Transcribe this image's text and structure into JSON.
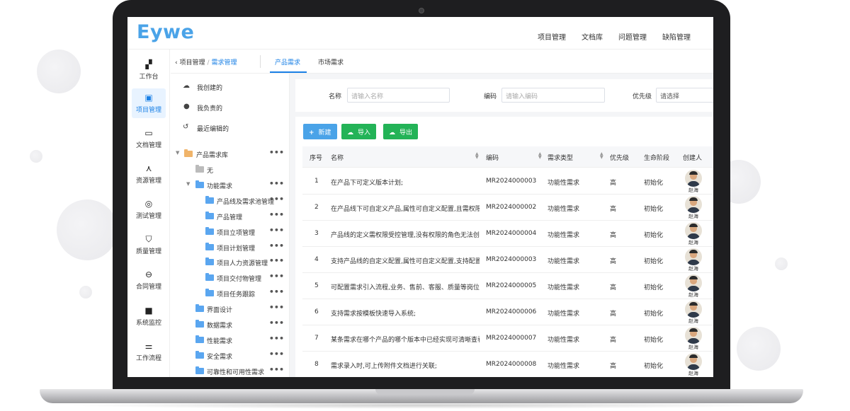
{
  "app": {
    "logo": "Eywe",
    "top_nav": [
      "项目管理",
      "文档库",
      "问题管理",
      "缺陷管理"
    ]
  },
  "sidebar": {
    "items": [
      {
        "label": "工作台",
        "icon": "dashboard-icon",
        "active": false
      },
      {
        "label": "项目管理",
        "icon": "clipboard-icon",
        "active": true
      },
      {
        "label": "文档管理",
        "icon": "folder-icon",
        "active": false
      },
      {
        "label": "资源管理",
        "icon": "network-icon",
        "active": false
      },
      {
        "label": "测试管理",
        "icon": "target-icon",
        "active": false
      },
      {
        "label": "质量管理",
        "icon": "shield-icon",
        "active": false
      },
      {
        "label": "合同管理",
        "icon": "contract-icon",
        "active": false
      },
      {
        "label": "系统监控",
        "icon": "camera-icon",
        "active": false
      },
      {
        "label": "工作流程",
        "icon": "sliders-icon",
        "active": false
      }
    ]
  },
  "breadcrumb": {
    "back_icon": "chevron-left-icon",
    "root": "项目管理",
    "current": "需求管理"
  },
  "tabs": [
    {
      "label": "产品需求",
      "active": true
    },
    {
      "label": "市场需求",
      "active": false
    }
  ],
  "quick_filters": [
    {
      "label": "我创建的",
      "icon": "cloud-icon"
    },
    {
      "label": "我负责的",
      "icon": "user-icon"
    },
    {
      "label": "最近编辑的",
      "icon": "history-icon"
    }
  ],
  "tree": {
    "root": "产品需求库",
    "more": "•••",
    "nodes": [
      {
        "label": "无",
        "level": 1
      },
      {
        "label": "功能需求",
        "level": 1,
        "expanded": true
      },
      {
        "label": "产品线及需求池管理",
        "level": 2
      },
      {
        "label": "产品管理",
        "level": 2
      },
      {
        "label": "项目立项管理",
        "level": 2
      },
      {
        "label": "项目计划管理",
        "level": 2
      },
      {
        "label": "项目人力资源管理",
        "level": 2
      },
      {
        "label": "项目交付物管理",
        "level": 2
      },
      {
        "label": "项目任务跟踪",
        "level": 2
      },
      {
        "label": "界面设计",
        "level": 1
      },
      {
        "label": "数据需求",
        "level": 1
      },
      {
        "label": "性能需求",
        "level": 1
      },
      {
        "label": "安全需求",
        "level": 1
      },
      {
        "label": "可靠性和可用性需求",
        "level": 1
      }
    ]
  },
  "filters": {
    "name_label": "名称",
    "name_placeholder": "请输入名称",
    "code_label": "编码",
    "code_placeholder": "请输入编码",
    "priority_label": "优先级",
    "priority_placeholder": "请选择"
  },
  "toolbar": {
    "new_label": "新建",
    "import_label": "导入",
    "export_label": "导出"
  },
  "table": {
    "headers": [
      "序号",
      "名称",
      "编码",
      "需求类型",
      "优先级",
      "生命阶段",
      "创建人"
    ],
    "rows": [
      {
        "no": "1",
        "name": "在产品下可定义版本计划;",
        "code": "MR2024000003",
        "type": "功能性需求",
        "priority": "高",
        "stage": "初始化",
        "creator": "赵海"
      },
      {
        "no": "2",
        "name": "在产品线下可自定义产品,属性可自定义配置,且需权限...",
        "code": "MR2024000002",
        "type": "功能性需求",
        "priority": "高",
        "stage": "初始化",
        "creator": "赵海"
      },
      {
        "no": "3",
        "name": "产品线的定义需权限受控管理,没有权限的角色无法创...",
        "code": "MR2024000004",
        "type": "功能性需求",
        "priority": "高",
        "stage": "初始化",
        "creator": "赵海"
      },
      {
        "no": "4",
        "name": "支持产品线的自定义配置,属性可自定义配置,支持配置...",
        "code": "MR2024000003",
        "type": "功能性需求",
        "priority": "高",
        "stage": "初始化",
        "creator": "赵海"
      },
      {
        "no": "5",
        "name": "可配置需求引入流程,业务、售前、客服、质量等岗位...",
        "code": "MR2024000005",
        "type": "功能性需求",
        "priority": "高",
        "stage": "初始化",
        "creator": "赵海"
      },
      {
        "no": "6",
        "name": "支持需求按模板快速导入系统;",
        "code": "MR2024000006",
        "type": "功能性需求",
        "priority": "高",
        "stage": "初始化",
        "creator": "赵海"
      },
      {
        "no": "7",
        "name": "某条需求在哪个产品的哪个版本中已经实现可清晰查看;",
        "code": "MR2024000007",
        "type": "功能性需求",
        "priority": "高",
        "stage": "初始化",
        "creator": "赵海"
      },
      {
        "no": "8",
        "name": "需求录入时,可上传附件文档进行关联;",
        "code": "MR2024000008",
        "type": "功能性需求",
        "priority": "高",
        "stage": "初始化",
        "creator": "赵海"
      }
    ]
  },
  "colors": {
    "accent": "#1a80e6",
    "logo": "#4aa3e8",
    "button_blue": "#4aa3e8",
    "button_green": "#23b357"
  }
}
